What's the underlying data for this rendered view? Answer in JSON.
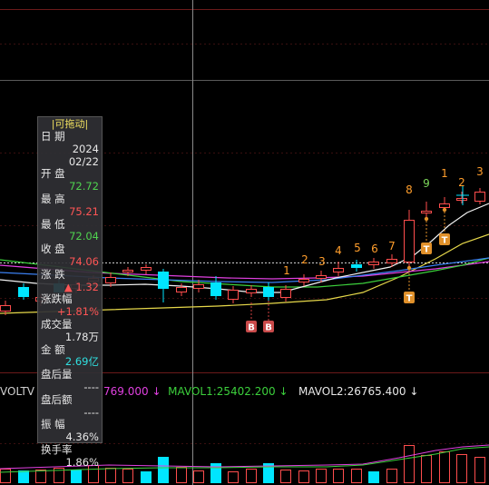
{
  "colors": {
    "up": "#ff4d4d",
    "down": "#00e5ff",
    "ma_white": "#f2f2f2",
    "ma_yellow": "#e6d84a",
    "ma_magenta": "#e040e0",
    "ma_green": "#3cd03c",
    "ma_blue": "#3a7ff0",
    "label_orange": "#ff9e2c",
    "label_green": "#7cd65a"
  },
  "tooltip": {
    "title": "|可拖动|",
    "date_label": "日  期",
    "date_year": "2024",
    "date_md": "02/22",
    "open_label": "开  盘",
    "open": "72.72",
    "high_label": "最  高",
    "high": "75.21",
    "low_label": "最  低",
    "low": "72.04",
    "close_label": "收  盘",
    "close": "74.06",
    "chg_label": "涨  跌",
    "chg": "▲ 1.32",
    "pct_label": "涨跌幅",
    "pct": "+1.81%",
    "vol_label": "成交量",
    "vol": "1.78万",
    "amt_label": "金  额",
    "amt": "2.69亿",
    "ahvol_label": "盘后量",
    "ahvol": "----",
    "ahamt_label": "盘后额",
    "ahamt": "----",
    "amp_label": "振  幅",
    "amp": "4.36%",
    "turn_label": "换手率",
    "turn": "1.86%"
  },
  "volume_legend": {
    "name": "VOLTV",
    "v1": "769.000",
    "v1_arrow": "↓",
    "mavol1": "MAVOL1:25402.200",
    "mavol1_arrow": "↓",
    "mavol2": "MAVOL2:26765.400",
    "mavol2_arrow": "↓"
  },
  "count_labels": [
    {
      "text": "1",
      "color": "orange"
    },
    {
      "text": "2",
      "color": "orange"
    },
    {
      "text": "3",
      "color": "orange"
    },
    {
      "text": "4",
      "color": "orange"
    },
    {
      "text": "5",
      "color": "orange"
    },
    {
      "text": "6",
      "color": "orange"
    },
    {
      "text": "7",
      "color": "orange"
    },
    {
      "text": "8",
      "color": "orange"
    },
    {
      "text": "9",
      "color": "green"
    },
    {
      "text": "1",
      "color": "orange"
    },
    {
      "text": "2",
      "color": "orange"
    },
    {
      "text": "3",
      "color": "orange"
    }
  ],
  "signals": [
    {
      "text": "B"
    },
    {
      "text": "B"
    },
    {
      "text": "T"
    },
    {
      "text": "T"
    },
    {
      "text": "T"
    }
  ]
}
